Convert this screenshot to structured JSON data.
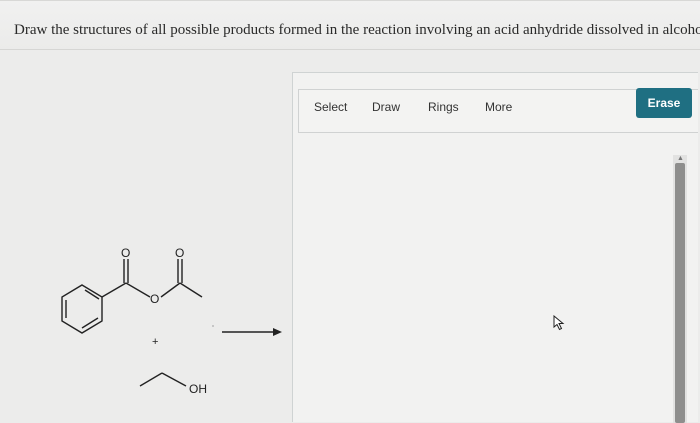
{
  "question": {
    "text": "Draw the structures of all possible products formed in the reaction involving an acid anhydride dissolved in alcohol."
  },
  "scheme": {
    "anhydride_o1": "O",
    "anhydride_o2": "O",
    "bridging_o": "O",
    "plus": "+",
    "alcohol_label": "OH"
  },
  "toolbar": {
    "select_label": "Select",
    "draw_label": "Draw",
    "rings_label": "Rings",
    "more_label": "More",
    "erase_label": "Erase"
  },
  "colors": {
    "accent": "#1f6f82",
    "background": "#ececeb"
  },
  "icons": {
    "cursor": "mouse-pointer-icon"
  }
}
